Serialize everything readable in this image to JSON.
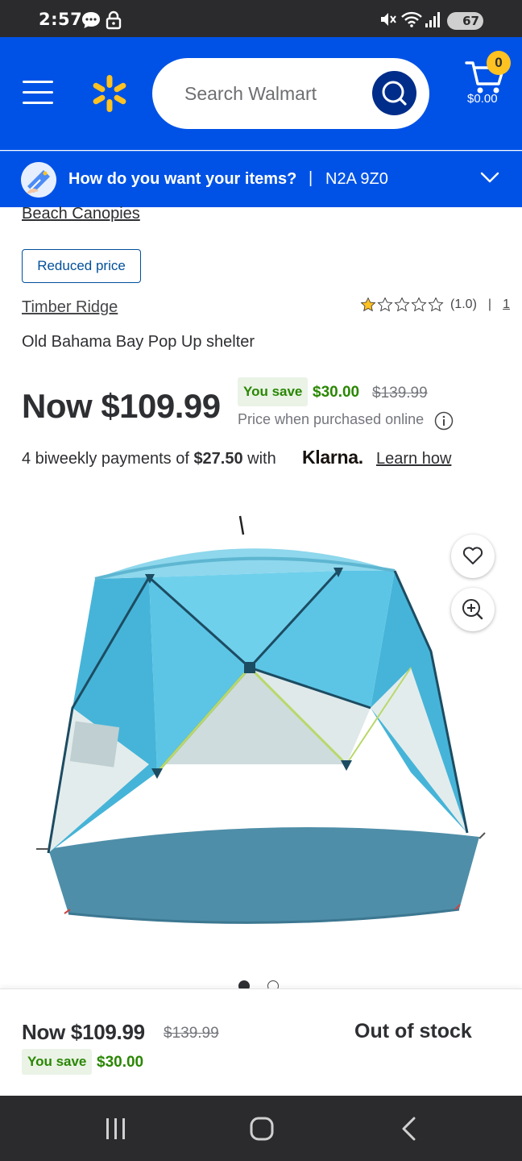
{
  "status_bar": {
    "time": "2:57",
    "battery": "67",
    "icons": [
      "chat-icon",
      "lock-icon",
      "mute-icon",
      "wifi-icon",
      "signal-icon",
      "battery-icon"
    ]
  },
  "header": {
    "search_placeholder": "Search Walmart",
    "cart_count": "0",
    "cart_total": "$0.00",
    "brand_color": "#0052e6",
    "spark_color": "#ffc220"
  },
  "delivery": {
    "question": "How do you want your items?",
    "separator": "|",
    "zip": "N2A 9Z0"
  },
  "product": {
    "breadcrumb": "Beach Canopies",
    "badge": "Reduced price",
    "brand": "Timber Ridge",
    "rating_value": 1.0,
    "rating_text": "(1.0)",
    "rating_sep": "|",
    "review_count": "1",
    "title": "Old Bahama Bay Pop Up shelter",
    "now_price": "Now $109.99",
    "you_save_label": "You save",
    "save_amount": "$30.00",
    "was_price": "$139.99",
    "online_note": "Price when purchased online",
    "installments": {
      "prefix": "4 biweekly payments of ",
      "amount": "$27.50",
      "suffix": " with",
      "provider": "Klarna.",
      "link": "Learn how"
    },
    "carousel": {
      "total": 2,
      "active": 1
    }
  },
  "sticky_bar": {
    "now_price": "Now $109.99",
    "was_price": "$139.99",
    "you_save_label": "You save",
    "save_amount": "$30.00",
    "availability": "Out of stock"
  },
  "nav_bar": {
    "buttons": [
      "recents-icon",
      "home-icon",
      "back-icon"
    ]
  }
}
